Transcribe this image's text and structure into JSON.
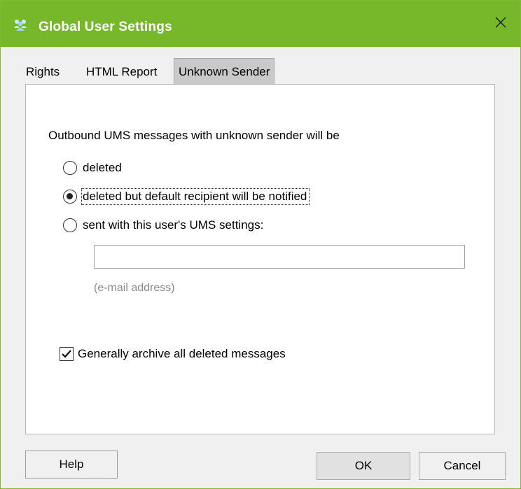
{
  "window": {
    "title": "Global User Settings",
    "title_icon": "users-icon",
    "accent_color": "#76b82a",
    "close_icon": "close-icon"
  },
  "tabs": [
    {
      "label": "Rights",
      "active": false
    },
    {
      "label": "HTML Report",
      "active": false
    },
    {
      "label": "Unknown Sender",
      "active": true
    }
  ],
  "panel": {
    "prompt": "Outbound UMS messages with unknown sender will be",
    "options": [
      {
        "label": "deleted",
        "selected": false
      },
      {
        "label": "deleted but default recipient will be notified",
        "selected": true
      },
      {
        "label": "sent with this user's UMS settings:",
        "selected": false
      }
    ],
    "email": {
      "value": "",
      "hint": "(e-mail address)"
    },
    "archive": {
      "label": "Generally archive all deleted messages",
      "checked": true
    }
  },
  "buttons": {
    "help": "Help",
    "ok": "OK",
    "cancel": "Cancel"
  }
}
